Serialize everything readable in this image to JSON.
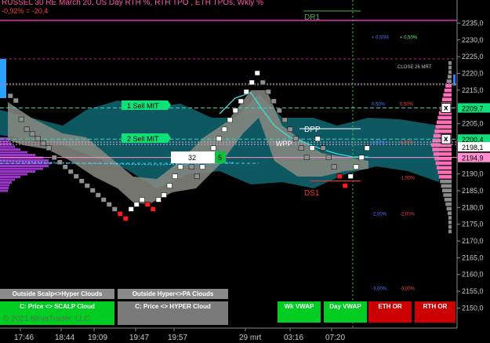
{
  "header": {
    "title": "RUSSEL 30 RE March 20, US Day RTH %, RTH TPO , ETH TPOs, Wkly %",
    "subtitle": "-0,92% = -20,4"
  },
  "price_axis": {
    "ticks": [
      "2235,0",
      "2230,0",
      "2225,0",
      "2220,0",
      "2215,0",
      "2210,0",
      "2205,0",
      "2200,0",
      "2195,0",
      "2190,0",
      "2185,0",
      "2180,0",
      "2175,0",
      "2170,0",
      "2165,0",
      "2160,0",
      "2155,0",
      "2150,0"
    ],
    "badges": [
      {
        "text": "2209,7",
        "price": 2209.7,
        "color": "#10e07a",
        "text_color": "#000000"
      },
      {
        "text": "2200,4",
        "price": 2200.4,
        "color": "#10e07a",
        "text_color": "#000000"
      },
      {
        "text": "2198,1",
        "price": 2198.1,
        "color": "#ffffff",
        "text_color": "#000000"
      },
      {
        "text": "2194,9",
        "price": 2194.9,
        "color": "#ff8fd0",
        "text_color": "#000000"
      }
    ]
  },
  "time_axis": {
    "ticks": [
      "17:46",
      "18:44",
      "19:09",
      "19:47",
      "19:57",
      "29 mrt",
      "03:16",
      "07:20"
    ]
  },
  "annotations": {
    "dr1": "DR1",
    "dpp": "DPP",
    "wpp": "WPP",
    "ds1": "DS1",
    "close_label": "CLOSE 26 MRT",
    "sell_mit_1": "1  Sell MIT",
    "sell_mit_2": "2  Sell MIT",
    "order_qty": "32",
    "order_count": "5",
    "close_x": "x"
  },
  "percent_labels": [
    {
      "a": "+ 0,50%",
      "b": "+ 0,50%",
      "price": 2230.3,
      "color": "#4a7dff"
    },
    {
      "a": "0,50%",
      "b": "0,50%",
      "price": 2210.4,
      "color": "#4a7dff"
    },
    {
      "a": "1,00%",
      "b": "1,00%",
      "price": 2199.0,
      "color": "#4a7dff"
    },
    {
      "a": "",
      "b": "-1,50%",
      "price": 2188.4,
      "color": "#ff4040"
    },
    {
      "a": "-2,00%",
      "b": "-2,00%",
      "price": 2177.6,
      "color": "#4a7dff"
    },
    {
      "a": "-3,00%",
      "b": "-3,00%",
      "price": 2155.4,
      "color": "#4a7dff"
    }
  ],
  "buttons": {
    "outside_scalp": "Outside Scalp<>Hyper Clouds",
    "outside_hyper": "Outside Hyper<>PA Clouds",
    "scalp_cloud": "C: Price <> SCALP Cloud",
    "hyper_cloud": "C: Price <> HYPER Cloud",
    "wk_vwap": "Wk VWAP",
    "day_vwap": "Day VWAP",
    "eth_or": "ETH OR",
    "rth_or": "RTH OR"
  },
  "copyright": "© 2021 NinjaTrader, LLC",
  "colors": {
    "axis_bg": "#000000",
    "axis_text": "#c8c8c8",
    "up_brick": "#ffffff",
    "down_brick": "#909090",
    "red_brick": "#ff1a1a",
    "cloud_teal": "#0f5e66",
    "cloud_grey": "#8a8a82",
    "green_button": "#00cc22",
    "red_button": "#cc0000",
    "grey_button": "#7a7a7a",
    "magenta_line": "#b0208a"
  },
  "chart_data": {
    "type": "renko",
    "x_labels": [
      "17:46",
      "18:44",
      "19:09",
      "19:47",
      "19:57",
      "29 mrt",
      "03:16",
      "07:20"
    ],
    "y_range": [
      2147,
      2237
    ],
    "brick_size": 1.4,
    "levels": {
      "dr1": 2235.8,
      "close_26_mrt": 2216.9,
      "sell_mit_1": 2209.7,
      "sell_mit_2": 2200.4,
      "dpp": 2204.2,
      "wpp": 2199.5,
      "last": 2198.1,
      "ds1": 2188.4
    },
    "series": [
      {
        "type": "bricks",
        "values": [
          {
            "c": 0,
            "y": 2214
          },
          {
            "c": 1,
            "y": 2212.6
          },
          {
            "c": 2,
            "y": 2207
          },
          {
            "c": 3,
            "y": 2204
          },
          {
            "c": 4,
            "y": 2202.6
          },
          {
            "c": 5,
            "y": 2201.2
          },
          {
            "c": 6,
            "y": 2199.8
          },
          {
            "c": 7,
            "y": 2198.4
          },
          {
            "c": 8,
            "y": 2195.6
          },
          {
            "c": 9,
            "y": 2194.2
          },
          {
            "c": 10,
            "y": 2192.8
          },
          {
            "c": 11,
            "y": 2191.4
          },
          {
            "c": 12,
            "y": 2190
          },
          {
            "c": 13,
            "y": 2188.6
          },
          {
            "c": 14,
            "y": 2187.2
          },
          {
            "c": 15,
            "y": 2185.8
          },
          {
            "c": 16,
            "y": 2184.4
          },
          {
            "c": 17,
            "y": 2183
          },
          {
            "c": 18,
            "y": 2181.6
          },
          {
            "c": 19,
            "y": 2180.2
          },
          {
            "c": 20,
            "y": 2178.8
          },
          {
            "c": 21,
            "y": 2177.4
          },
          {
            "c": 22,
            "y": 2180.2
          },
          {
            "c": 23,
            "y": 2181.6
          },
          {
            "c": 24,
            "y": 2183
          },
          {
            "c": 25,
            "y": 2181.6
          },
          {
            "c": 26,
            "y": 2180.2
          },
          {
            "c": 27,
            "y": 2183
          },
          {
            "c": 28,
            "y": 2184.4
          },
          {
            "c": 29,
            "y": 2187.2
          },
          {
            "c": 30,
            "y": 2190
          },
          {
            "c": 31,
            "y": 2192.8
          },
          {
            "c": 32,
            "y": 2195.6
          },
          {
            "c": 33,
            "y": 2192.8
          },
          {
            "c": 34,
            "y": 2190
          },
          {
            "c": 35,
            "y": 2192.8
          },
          {
            "c": 36,
            "y": 2195.6
          },
          {
            "c": 37,
            "y": 2198.4
          },
          {
            "c": 38,
            "y": 2201.2
          },
          {
            "c": 39,
            "y": 2204
          },
          {
            "c": 40,
            "y": 2206.8
          },
          {
            "c": 41,
            "y": 2209.6
          },
          {
            "c": 42,
            "y": 2212.4
          },
          {
            "c": 43,
            "y": 2215.2
          },
          {
            "c": 44,
            "y": 2218
          },
          {
            "c": 45,
            "y": 2220.8
          },
          {
            "c": 46,
            "y": 2218
          },
          {
            "c": 47,
            "y": 2215.2
          },
          {
            "c": 48,
            "y": 2212.4
          },
          {
            "c": 49,
            "y": 2209.6
          },
          {
            "c": 50,
            "y": 2206.8
          },
          {
            "c": 51,
            "y": 2204
          },
          {
            "c": 52,
            "y": 2201.2
          },
          {
            "c": 53,
            "y": 2198.4
          },
          {
            "c": 54,
            "y": 2195.6
          },
          {
            "c": 55,
            "y": 2198.4
          },
          {
            "c": 56,
            "y": 2201.2
          },
          {
            "c": 57,
            "y": 2198.4
          },
          {
            "c": 58,
            "y": 2195.6
          },
          {
            "c": 59,
            "y": 2192.8
          },
          {
            "c": 60,
            "y": 2190
          },
          {
            "c": 61,
            "y": 2187.2
          },
          {
            "c": 62,
            "y": 2190
          },
          {
            "c": 63,
            "y": 2192.8
          },
          {
            "c": 64,
            "y": 2195.6
          },
          {
            "c": 65,
            "y": 2198.4
          }
        ]
      }
    ]
  }
}
